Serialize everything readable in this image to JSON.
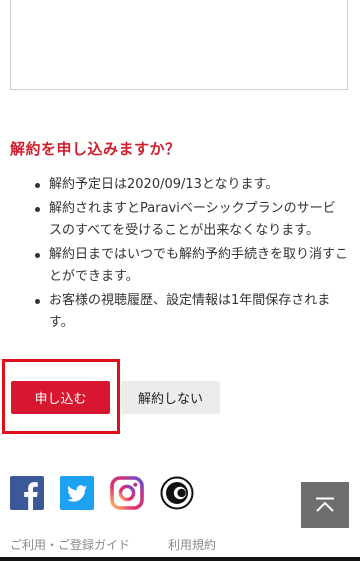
{
  "cancellation": {
    "heading": "解約を申し込みますか？",
    "notes": [
      "解約予定日は2020/09/13となります。",
      "解約されますとParaviベーシックプランのサービスのすべてを受けることが出来なくなります。",
      "解約日まではいつでも解約予約手続きを取り消すことができます。",
      "お客様の視聴履歴、設定情報は1年間保存されます。"
    ],
    "apply_label": "申し込む",
    "decline_label": "解約しない"
  },
  "social": [
    {
      "icon": "facebook-icon",
      "color": "#3b5998"
    },
    {
      "icon": "twitter-icon",
      "color": "#1da1f2"
    },
    {
      "icon": "instagram-icon",
      "color": "#c13584"
    },
    {
      "icon": "c-logo-icon",
      "color": "#111111"
    }
  ],
  "to_top_icon": "chevron-up-icon",
  "footer": {
    "links": [
      "ご利用・ご登録ガイド",
      "利用規約"
    ]
  },
  "colors": {
    "accent": "#d7172f",
    "highlight_frame": "#e0101b",
    "heading": "#d0202e"
  }
}
